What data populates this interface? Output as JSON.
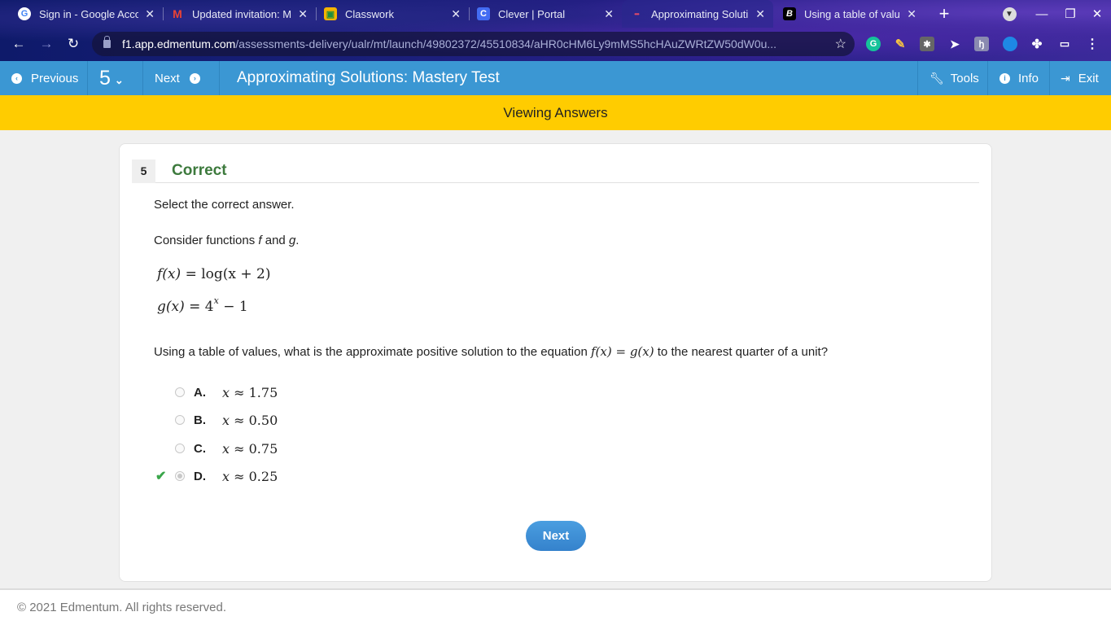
{
  "browser": {
    "tabs": [
      {
        "title": "Sign in - Google Acco",
        "favicon": "google-icon",
        "favicon_glyph": "G",
        "favicon_color": "#ffffff",
        "active": false
      },
      {
        "title": "Updated invitation: M",
        "favicon": "gmail-icon",
        "favicon_glyph": "M",
        "favicon_color": "#ea4335",
        "active": false
      },
      {
        "title": "Classwork",
        "favicon": "google-classroom-icon",
        "favicon_glyph": "▣",
        "favicon_color": "#f4b400",
        "active": false
      },
      {
        "title": "Clever | Portal",
        "favicon": "clever-icon",
        "favicon_glyph": "C",
        "favicon_color": "#436cf2",
        "active": false
      },
      {
        "title": "Approximating Soluti",
        "favicon": "edmentum-icon",
        "favicon_glyph": "•••",
        "favicon_color": "#e24a6a",
        "active": true
      },
      {
        "title": "Using a table of valu",
        "favicon": "brainly-icon",
        "favicon_glyph": "B",
        "favicon_color": "#000000",
        "active": false
      }
    ],
    "new_tab_label": "+",
    "url_host": "f1.app.edmentum.com",
    "url_path": "/assessments-delivery/ualr/mt/launch/49802372/45510834/aHR0cHM6Ly9mMS5hcHAuZWRtZW50dW0u..."
  },
  "app": {
    "nav": {
      "previous_label": "Previous",
      "question_number": "5",
      "next_label": "Next"
    },
    "title": "Approximating Solutions: Mastery Test",
    "tools_label": "Tools",
    "info_label": "Info",
    "exit_label": "Exit",
    "banner": "Viewing Answers"
  },
  "question": {
    "number": "5",
    "status": "Correct",
    "status_color": "#3d7a3d",
    "instruction": "Select the correct answer.",
    "intro_prefix": "Consider functions ",
    "intro_f": "f",
    "intro_and": " and ",
    "intro_g": "g",
    "intro_suffix": ".",
    "f_lhs": "f(x)",
    "f_rhs": "= log(x + 2)",
    "g_lhs": "g(x)",
    "g_rhs_base": "= 4",
    "g_rhs_exp": "x",
    "g_rhs_tail": " − 1",
    "prompt_prefix": "Using a table of values, what is the approximate positive solution to the equation ",
    "prompt_eq": "f(x) = g(x)",
    "prompt_suffix": " to the nearest quarter of a unit?",
    "options": [
      {
        "letter": "A.",
        "var": "x",
        "approx": "≈",
        "value": "1.75",
        "selected": false,
        "correct_mark": false
      },
      {
        "letter": "B.",
        "var": "x",
        "approx": "≈",
        "value": "0.50",
        "selected": false,
        "correct_mark": false
      },
      {
        "letter": "C.",
        "var": "x",
        "approx": "≈",
        "value": "0.75",
        "selected": false,
        "correct_mark": false
      },
      {
        "letter": "D.",
        "var": "x",
        "approx": "≈",
        "value": "0.25",
        "selected": true,
        "correct_mark": true
      }
    ],
    "next_button": "Next"
  },
  "footer": {
    "copyright": "© 2021 Edmentum. All rights reserved."
  }
}
